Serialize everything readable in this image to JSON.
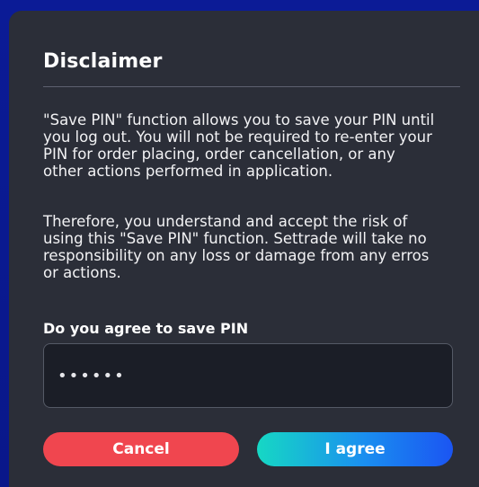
{
  "dialog": {
    "title": "Disclaimer",
    "paragraph_1": "\"Save PIN\" function allows you to save your PIN until you log out. You will not be required to re-enter your PIN for order placing, order cancellation, or any other actions performed in application.",
    "paragraph_2": "Therefore, you understand and accept the risk of using this \"Save PIN\" function. Settrade will take no responsibility on any loss or damage from any erros or actions.",
    "question": "Do you agree to save PIN",
    "pin_value": "••••••",
    "cancel_label": "Cancel",
    "agree_label": "I agree"
  },
  "colors": {
    "backdrop": "#0a1a8c",
    "dialog_bg": "#2b2e38",
    "cancel": "#f0464f",
    "agree_start": "#16d8c4",
    "agree_end": "#1b55f2"
  }
}
